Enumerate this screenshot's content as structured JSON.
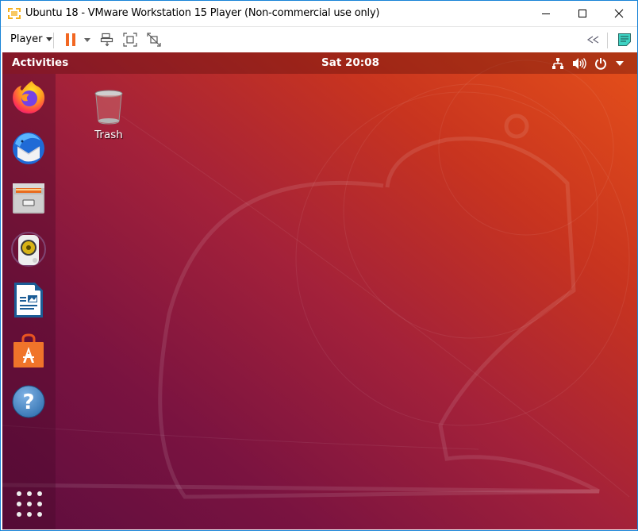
{
  "window": {
    "title": "Ubuntu 18 - VMware Workstation 15 Player (Non-commercial use only)",
    "controls": [
      "minimize",
      "maximize",
      "close"
    ]
  },
  "toolbar": {
    "player_menu_label": "Player",
    "buttons": [
      {
        "name": "pause",
        "icon": "pause-icon",
        "accent": "#f26722"
      },
      {
        "name": "pause-options",
        "icon": "chevron-down-icon"
      },
      {
        "name": "send-ctrl-alt-del",
        "icon": "send-keys-icon"
      },
      {
        "name": "full-screen",
        "icon": "fullscreen-icon"
      },
      {
        "name": "unity",
        "icon": "unity-icon"
      },
      {
        "name": "collapse",
        "icon": "double-chevron-left-icon"
      },
      {
        "name": "notes",
        "icon": "sticky-note-icon",
        "accent": "#3ed3c4"
      }
    ]
  },
  "ubuntu": {
    "topbar": {
      "activities_label": "Activities",
      "clock": "Sat 20:08",
      "tray_icons": [
        "network-icon",
        "volume-icon",
        "power-icon",
        "chevron-down-icon"
      ]
    },
    "dock": {
      "items": [
        {
          "name": "Firefox",
          "icon": "firefox-icon"
        },
        {
          "name": "Thunderbird",
          "icon": "thunderbird-icon"
        },
        {
          "name": "Files",
          "icon": "files-icon"
        },
        {
          "name": "Rhythmbox",
          "icon": "rhythmbox-icon"
        },
        {
          "name": "LibreOffice Writer",
          "icon": "writer-icon"
        },
        {
          "name": "Ubuntu Software",
          "icon": "software-icon"
        },
        {
          "name": "Help",
          "icon": "help-icon"
        }
      ],
      "show_apps": "apps-grid-icon"
    },
    "desktop": {
      "icons": [
        {
          "label": "Trash",
          "icon": "trash-icon"
        }
      ]
    },
    "colors": {
      "wallpaper_start": "#5d0d3e",
      "wallpaper_end": "#e5501a"
    }
  }
}
